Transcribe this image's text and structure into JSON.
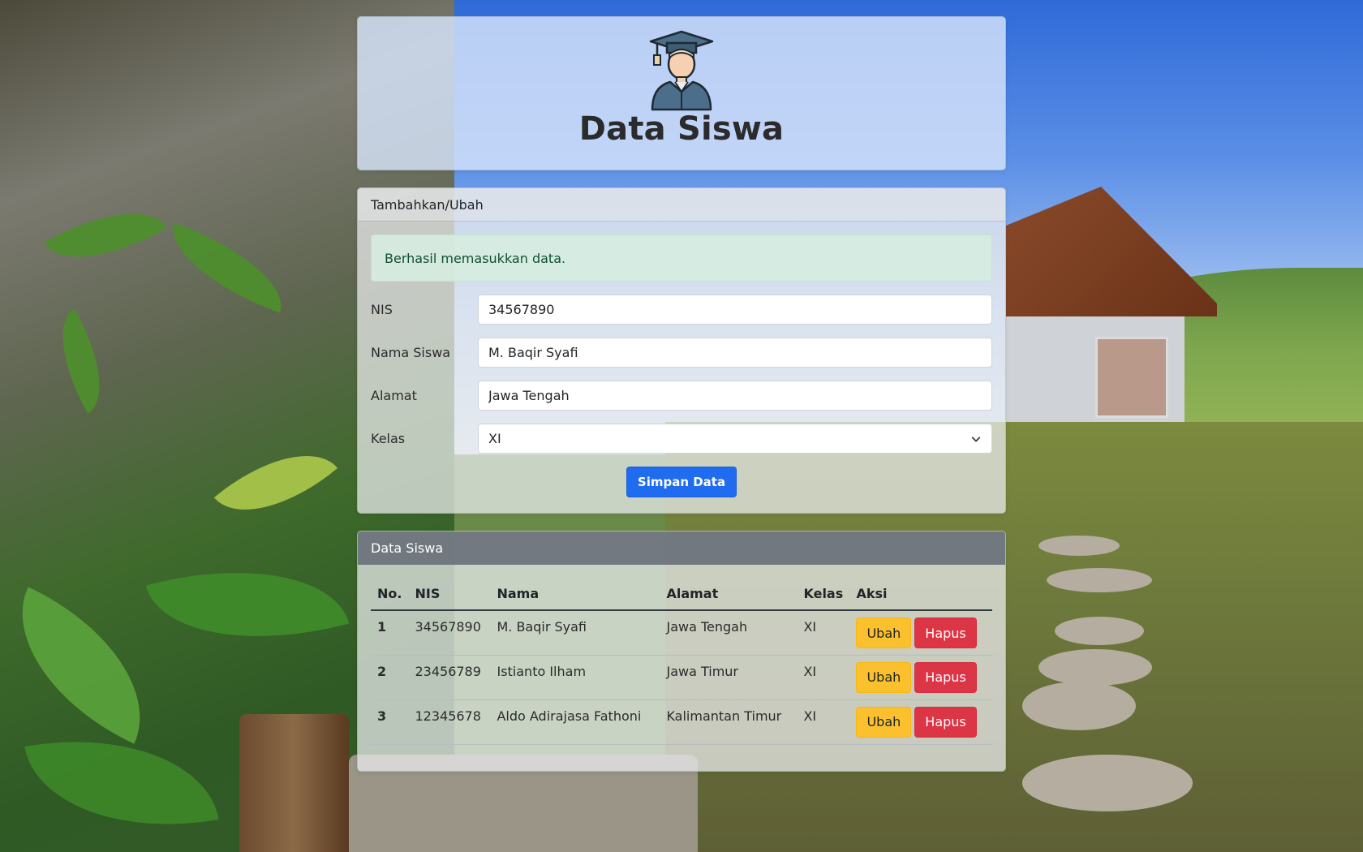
{
  "header": {
    "title": "Data Siswa",
    "logo_icon": "student-graduate-icon"
  },
  "form": {
    "header": "Tambahkan/Ubah",
    "alert": "Berhasil memasukkan data.",
    "fields": [
      {
        "label": "NIS",
        "value": "34567890"
      },
      {
        "label": "Nama Siswa",
        "value": "M. Baqir Syafi"
      },
      {
        "label": "Alamat",
        "value": "Jawa Tengah"
      },
      {
        "label": "Kelas",
        "value": "XI"
      }
    ],
    "submit_label": "Simpan Data"
  },
  "table": {
    "header": "Data Siswa",
    "columns": [
      "No.",
      "NIS",
      "Nama",
      "Alamat",
      "Kelas",
      "Aksi"
    ],
    "rows": [
      {
        "no": "1",
        "nis": "34567890",
        "nama": "M. Baqir Syafi",
        "alamat": "Jawa Tengah",
        "kelas": "XI"
      },
      {
        "no": "2",
        "nis": "23456789",
        "nama": "Istianto Ilham",
        "alamat": "Jawa Timur",
        "kelas": "XI"
      },
      {
        "no": "3",
        "nis": "12345678",
        "nama": "Aldo Adirajasa Fathoni",
        "alamat": "Kalimantan Timur",
        "kelas": "XI"
      }
    ],
    "edit_label": "Ubah",
    "delete_label": "Hapus"
  },
  "colors": {
    "primary": "#1f6cf0",
    "warning": "#fbc02d",
    "danger": "#dc3545",
    "success_bg": "#d6ece0",
    "table_header_bg": "#6e757d"
  }
}
